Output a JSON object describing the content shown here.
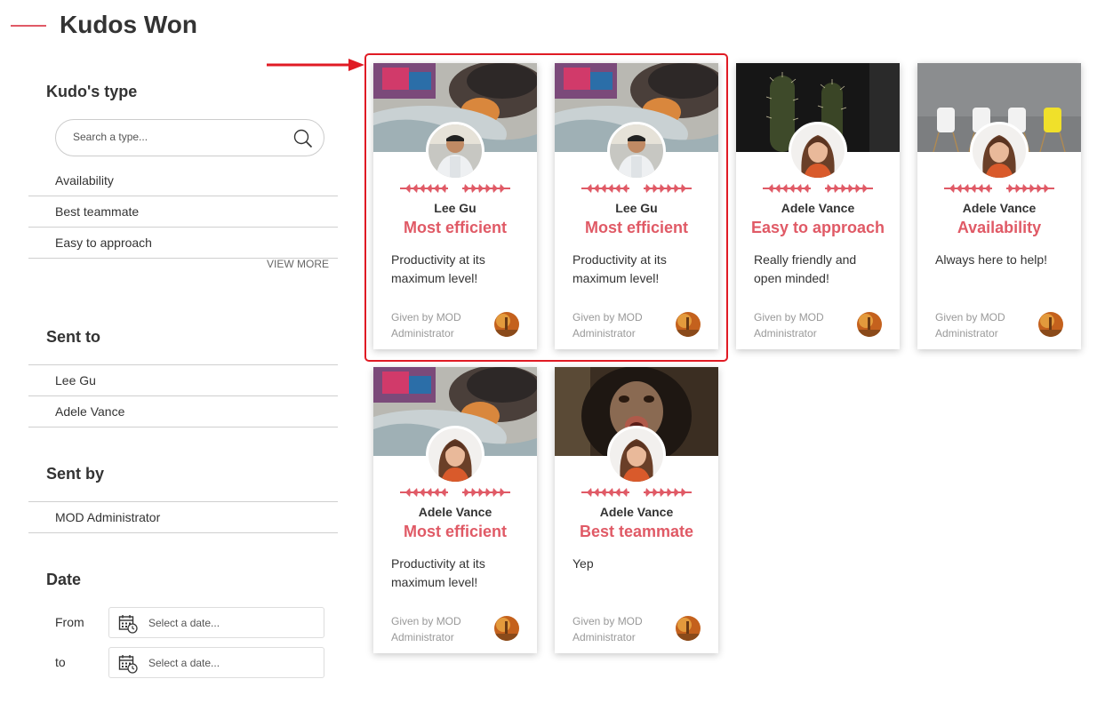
{
  "page": {
    "title": "Kudos Won"
  },
  "filters": {
    "type": {
      "title": "Kudo's type",
      "search_placeholder": "Search a type...",
      "items": [
        "Availability",
        "Best teammate",
        "Easy to approach"
      ],
      "view_more": "VIEW MORE"
    },
    "sent_to": {
      "title": "Sent to",
      "items": [
        "Lee Gu",
        "Adele Vance"
      ]
    },
    "sent_by": {
      "title": "Sent by",
      "items": [
        "MOD Administrator"
      ]
    },
    "date": {
      "title": "Date",
      "from_label": "From",
      "to_label": "to",
      "placeholder": "Select a date..."
    }
  },
  "cards": [
    {
      "name": "Lee Gu",
      "kudo": "Most efficient",
      "message": "Productivity at its maximum level!",
      "given_by": "Given by MOD Administrator",
      "image": "cat-and-man-photo"
    },
    {
      "name": "Lee Gu",
      "kudo": "Most efficient",
      "message": "Productivity at its maximum level!",
      "given_by": "Given by MOD Administrator",
      "image": "cat-and-man-photo"
    },
    {
      "name": "Adele Vance",
      "kudo": "Easy to approach",
      "message": "Really friendly and open minded!",
      "given_by": "Given by MOD Administrator",
      "image": "cactus-photo"
    },
    {
      "name": "Adele Vance",
      "kudo": "Availability",
      "message": "Always here to help!",
      "given_by": "Given by MOD Administrator",
      "image": "chairs-photo"
    },
    {
      "name": "Adele Vance",
      "kudo": "Most efficient",
      "message": "Productivity at its maximum level!",
      "given_by": "Given by MOD Administrator",
      "image": "cat-and-man-photo"
    },
    {
      "name": "Adele Vance",
      "kudo": "Best teammate",
      "message": "Yep",
      "given_by": "Given by MOD Administrator",
      "image": "chimpanzee-photo"
    }
  ],
  "colors": {
    "accent": "#e05a66",
    "highlight": "#e01b24"
  }
}
